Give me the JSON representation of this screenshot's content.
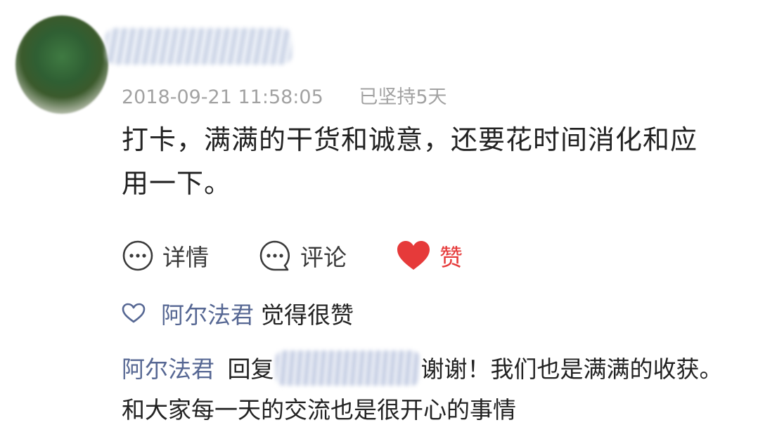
{
  "post": {
    "timestamp": "2018-09-21 11:58:05",
    "streak": "已坚持5天",
    "content": "打卡，满满的干货和诚意，还要花时间消化和应用一下。"
  },
  "actions": {
    "detail_label": "详情",
    "comment_label": "评论",
    "like_label": "赞"
  },
  "likes": {
    "user": "阿尔法君",
    "text": "觉得很赞"
  },
  "reply": {
    "author": "阿尔法君",
    "verb": "回复",
    "text": "谢谢！我们也是满满的收获。和大家每一天的交流也是很开心的事情"
  },
  "colors": {
    "accent_link": "#566793",
    "like_red": "#e63a3a",
    "meta_gray": "#a2a2a2"
  }
}
